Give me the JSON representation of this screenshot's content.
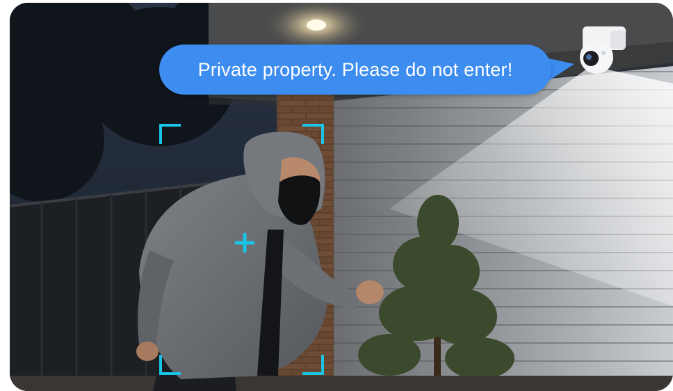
{
  "speech_bubble": {
    "text": "Private property. Please do not enter!",
    "color": "#3d8cf0"
  },
  "detection_overlay": {
    "color": "#19c4e6",
    "center_mark": "crosshair-plus-icon"
  },
  "camera": {
    "icon": "security-camera-icon"
  }
}
